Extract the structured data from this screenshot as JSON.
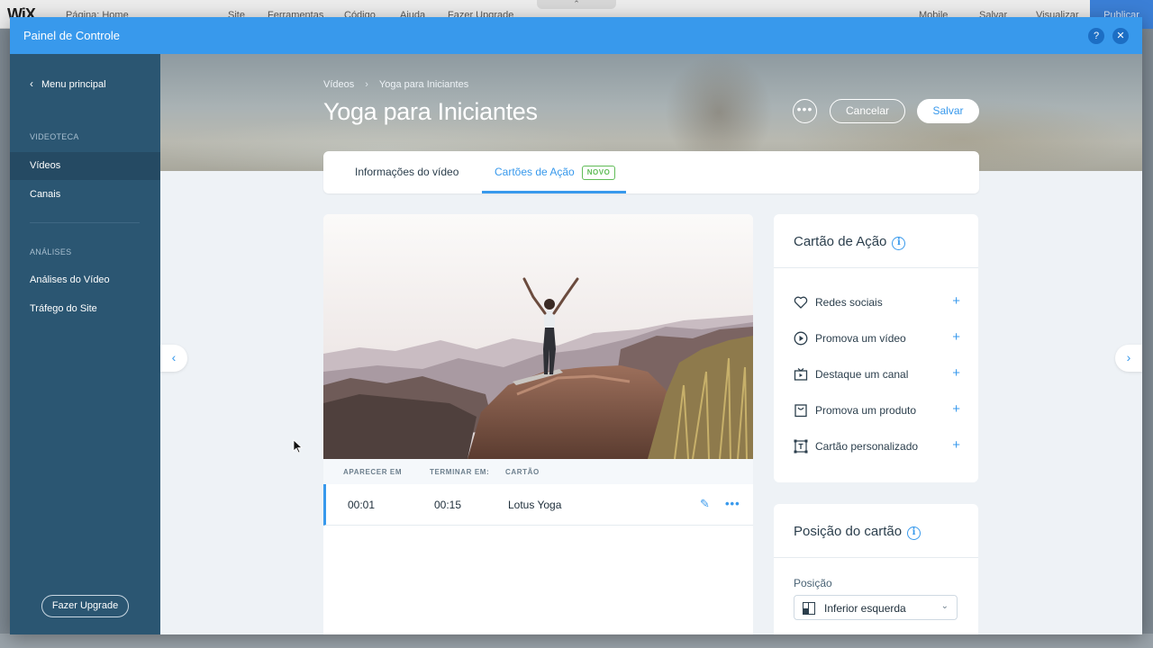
{
  "editor": {
    "logo": "WiX",
    "page_label": "Página: Home",
    "menu": [
      "Site",
      "Ferramentas",
      "Código",
      "Ajuda",
      "Fazer Upgrade"
    ],
    "mobile": "Mobile",
    "save": "Salvar",
    "preview": "Visualizar",
    "publish": "Publicar"
  },
  "modal": {
    "title": "Painel de Controle",
    "help": "?",
    "close": "✕"
  },
  "sidebar": {
    "back_label": "Menu principal",
    "sections": [
      {
        "title": "VIDEOTECA",
        "items": [
          "Vídeos",
          "Canais"
        ]
      },
      {
        "title": "ANÁLISES",
        "items": [
          "Análises do Vídeo",
          "Tráfego do Site"
        ]
      }
    ],
    "active_item": "Vídeos",
    "upgrade_label": "Fazer Upgrade"
  },
  "header": {
    "breadcrumb": [
      "Vídeos",
      "Yoga para Iniciantes"
    ],
    "title": "Yoga para Iniciantes",
    "more_label": "•••",
    "cancel_label": "Cancelar",
    "save_label": "Salvar"
  },
  "tabs": [
    {
      "label": "Informações do vídeo",
      "active": false
    },
    {
      "label": "Cartões de Ação",
      "active": true,
      "badge": "NOVO"
    }
  ],
  "cards_table": {
    "columns": [
      "APARECER EM",
      "TERMINAR EM:",
      "CARTÃO"
    ],
    "rows": [
      {
        "start": "00:01",
        "end": "00:15",
        "card": "Lotus Yoga"
      }
    ]
  },
  "action_panel": {
    "title": "Cartão de Ação",
    "items": [
      {
        "label": "Redes sociais",
        "icon": "heart-icon"
      },
      {
        "label": "Promova um vídeo",
        "icon": "play-circle-icon"
      },
      {
        "label": "Destaque um canal",
        "icon": "tv-channel-icon"
      },
      {
        "label": "Promova um produto",
        "icon": "shopping-bag-icon"
      },
      {
        "label": "Cartão personalizado",
        "icon": "text-frame-icon"
      }
    ]
  },
  "position_panel": {
    "title": "Posição do cartão",
    "field_label": "Posição",
    "selected": "Inferior esquerda"
  },
  "colors": {
    "accent": "#3899ec",
    "sidebar": "#2b5672",
    "sidebar_active": "#254a63",
    "badge": "#60bc57"
  }
}
